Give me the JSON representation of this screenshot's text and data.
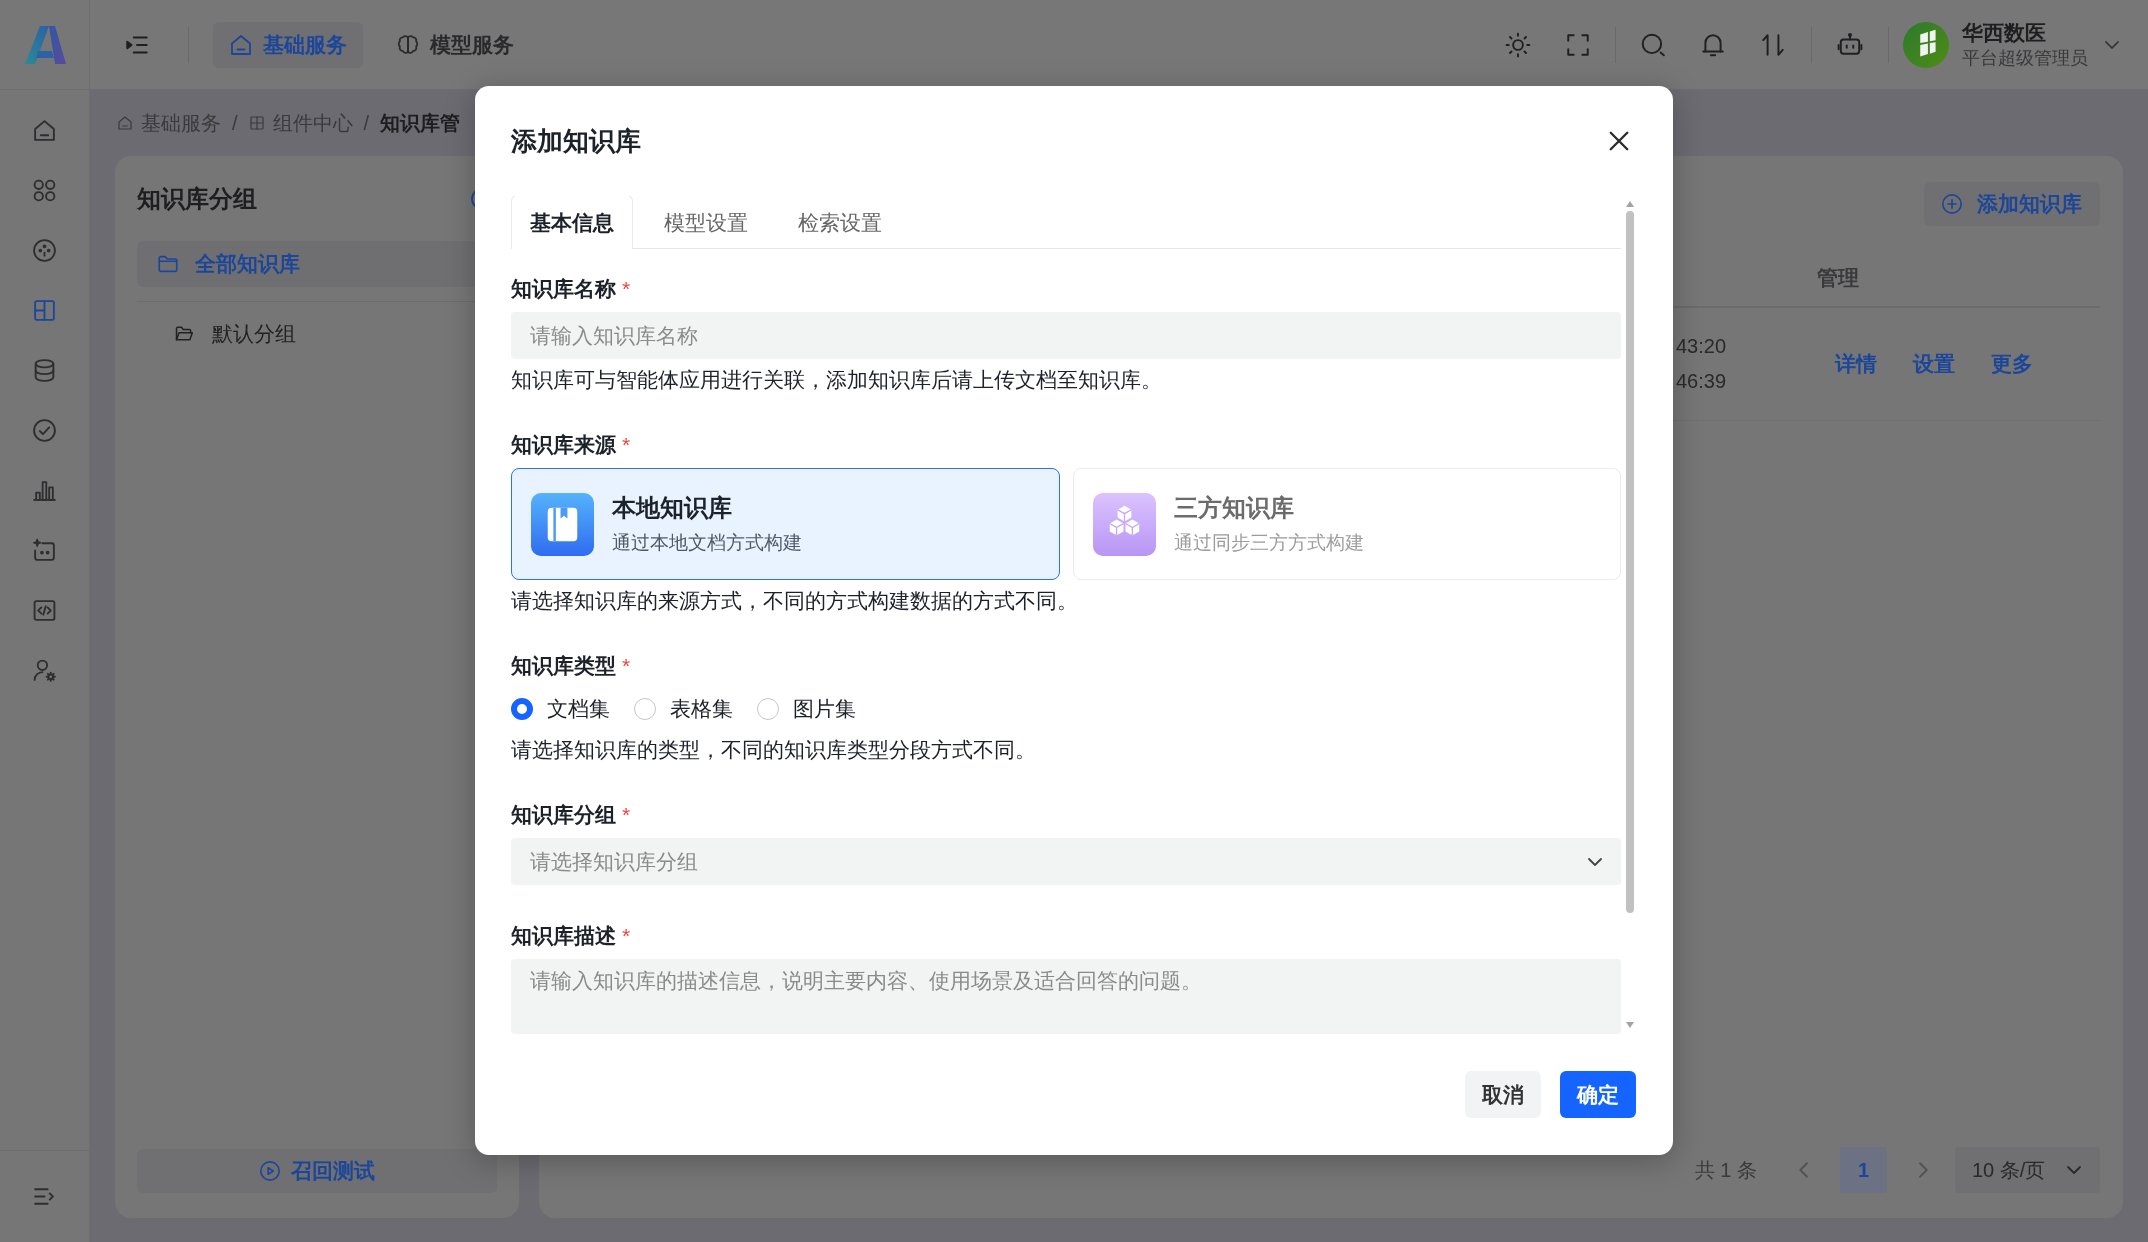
{
  "top_bar": {
    "nav_tabs": [
      {
        "label": "基础服务",
        "selected": true
      },
      {
        "label": "模型服务",
        "selected": false
      }
    ],
    "user": {
      "name": "华西数医",
      "role": "平台超级管理员"
    }
  },
  "sidebar": {
    "items": [
      {
        "selected": false
      },
      {
        "selected": false
      },
      {
        "selected": false
      },
      {
        "selected": true
      },
      {
        "selected": false
      },
      {
        "selected": false
      },
      {
        "selected": false
      },
      {
        "selected": false
      },
      {
        "selected": false
      },
      {
        "selected": false
      }
    ]
  },
  "breadcrumb": {
    "items": [
      "基础服务",
      "组件中心",
      "知识库管"
    ],
    "separators": [
      "/",
      "/"
    ]
  },
  "group_panel": {
    "title": "知识库分组",
    "groups": [
      {
        "label": "全部知识库",
        "selected": true,
        "children": [
          {
            "label": "默认分组",
            "selected": false
          }
        ]
      }
    ],
    "recall_button": "召回测试"
  },
  "list_panel": {
    "add_button": "添加知识库",
    "table": {
      "columns": [
        {
          "label": "管理"
        }
      ],
      "rows": [
        {
          "times": [
            "43:20",
            "46:39"
          ],
          "actions": [
            "详情",
            "设置",
            "更多"
          ]
        }
      ]
    },
    "pagination": {
      "total": "共 1 条",
      "pages": [
        {
          "label": "1",
          "selected": true
        }
      ],
      "page_size": "10 条/页"
    }
  },
  "dialog": {
    "title": "添加知识库",
    "tabs": [
      {
        "label": "基本信息",
        "selected": true
      },
      {
        "label": "模型设置",
        "selected": false
      },
      {
        "label": "检索设置",
        "selected": false
      }
    ],
    "fields": [
      {
        "kind": "text",
        "label": "知识库名称",
        "required_mark": "*",
        "placeholder": "请输入知识库名称",
        "help": "知识库可与智能体应用进行关联，添加知识库后请上传文档至知识库。"
      },
      {
        "kind": "source",
        "label": "知识库来源",
        "required_mark": "*",
        "options": [
          {
            "title": "本地知识库",
            "description": "通过本地文档方式构建",
            "selected": true,
            "disabled": false
          },
          {
            "title": "三方知识库",
            "description": "通过同步三方方式构建",
            "selected": false,
            "disabled": true
          }
        ],
        "help": "请选择知识库的来源方式，不同的方式构建数据的方式不同。"
      },
      {
        "kind": "radio",
        "label": "知识库类型",
        "required_mark": "*",
        "options": [
          {
            "label": "文档集",
            "selected": true
          },
          {
            "label": "表格集",
            "selected": false
          },
          {
            "label": "图片集",
            "selected": false
          }
        ],
        "help": "请选择知识库的类型，不同的知识库类型分段方式不同。"
      },
      {
        "kind": "select",
        "label": "知识库分组",
        "required_mark": "*",
        "placeholder": "请选择知识库分组"
      },
      {
        "kind": "textarea",
        "label": "知识库描述",
        "required_mark": "*",
        "placeholder": "请输入知识库的描述信息，说明主要内容、使用场景及适合回答的问题。"
      }
    ],
    "buttons": [
      {
        "label": "取消",
        "kind": "secondary"
      },
      {
        "label": "确定",
        "kind": "primary"
      }
    ]
  }
}
